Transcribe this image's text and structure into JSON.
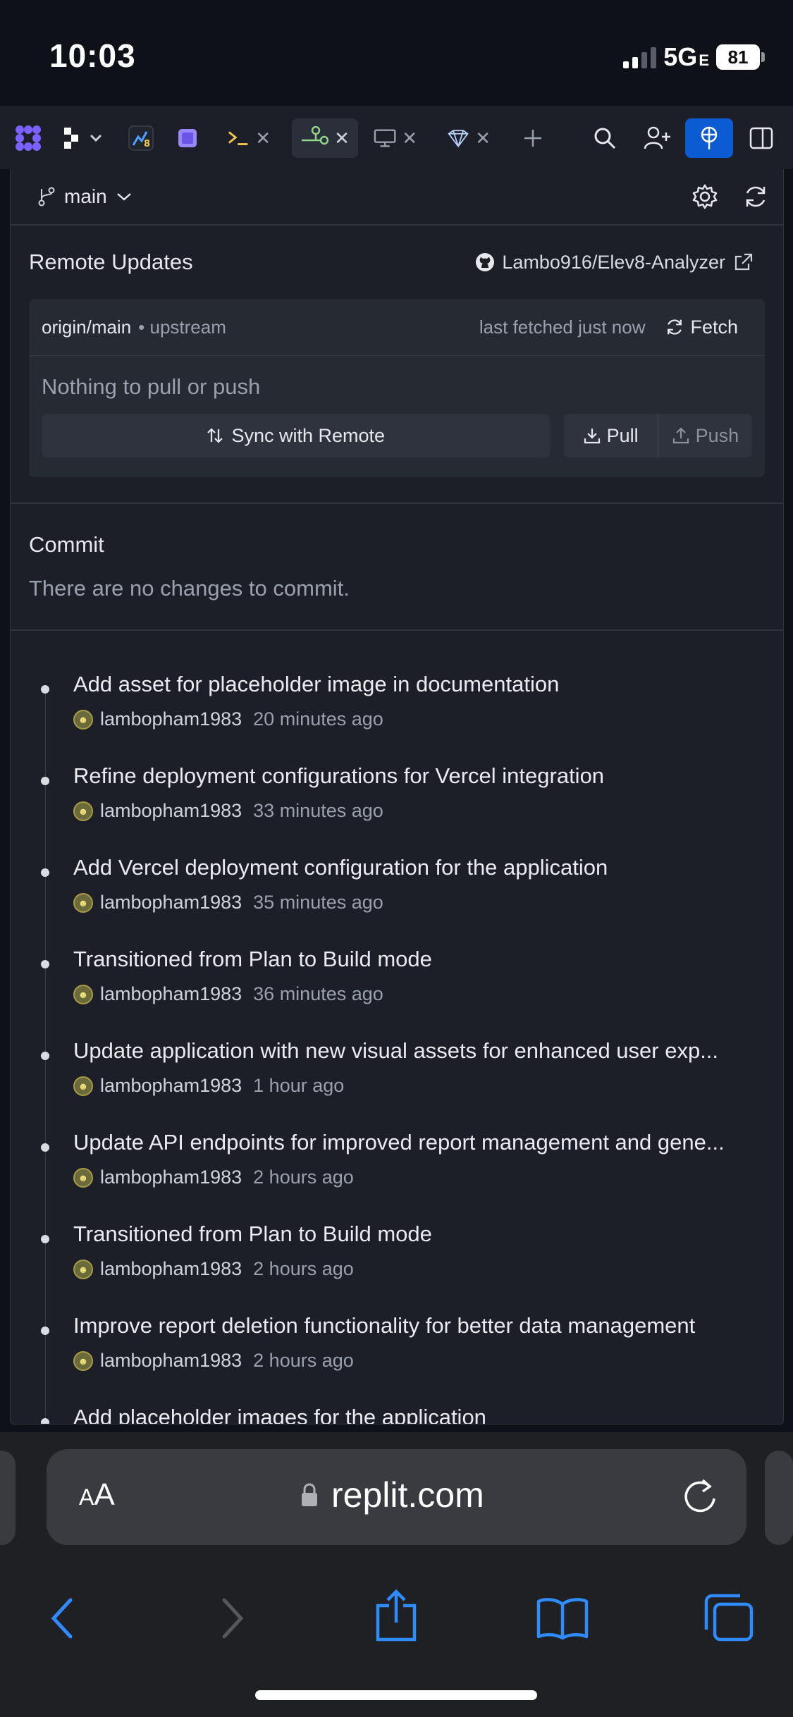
{
  "status_bar": {
    "time": "10:03",
    "network": "5G",
    "network_suffix": "E",
    "battery": "81"
  },
  "toolbar": {
    "items": [
      {
        "name": "apps-icon"
      },
      {
        "name": "workspace-switcher-icon"
      },
      {
        "name": "repl-avatar-icon"
      },
      {
        "name": "preview-square-icon"
      },
      {
        "name": "shell-tab"
      },
      {
        "name": "git-tab"
      },
      {
        "name": "webview-tab"
      },
      {
        "name": "agent-tab"
      },
      {
        "name": "new-tab"
      },
      {
        "name": "search-icon"
      },
      {
        "name": "invite-icon"
      },
      {
        "name": "deploy-icon"
      },
      {
        "name": "sidebar-toggle-icon"
      }
    ],
    "colors": {
      "accent_blue": "#0b5bd3",
      "git_green": "#8fd48a",
      "shell_yellow": "#f2c94c",
      "purple": "#7b61ff"
    }
  },
  "branch": {
    "name": "main"
  },
  "remote": {
    "title": "Remote Updates",
    "repo": "Lambo916/Elev8-Analyzer",
    "origin": "origin/main",
    "upstream": "• upstream",
    "fetched": "last fetched just now",
    "fetch_label": "Fetch",
    "status": "Nothing to pull or push",
    "sync_label": "Sync with Remote",
    "pull_label": "Pull",
    "push_label": "Push"
  },
  "commit": {
    "title": "Commit",
    "empty_message": "There are no changes to commit."
  },
  "history": [
    {
      "message": "Add asset for placeholder image in documentation",
      "author": "lambopham1983",
      "time": "20 minutes ago"
    },
    {
      "message": "Refine deployment configurations for Vercel integration",
      "author": "lambopham1983",
      "time": "33 minutes ago"
    },
    {
      "message": "Add Vercel deployment configuration for the application",
      "author": "lambopham1983",
      "time": "35 minutes ago"
    },
    {
      "message": "Transitioned from Plan to Build mode",
      "author": "lambopham1983",
      "time": "36 minutes ago"
    },
    {
      "message": "Update application with new visual assets for enhanced user exp...",
      "author": "lambopham1983",
      "time": "1 hour ago"
    },
    {
      "message": "Update API endpoints for improved report management and gene...",
      "author": "lambopham1983",
      "time": "2 hours ago"
    },
    {
      "message": "Transitioned from Plan to Build mode",
      "author": "lambopham1983",
      "time": "2 hours ago"
    },
    {
      "message": "Improve report deletion functionality for better data management",
      "author": "lambopham1983",
      "time": "2 hours ago"
    },
    {
      "message": "Add placeholder images for the application",
      "author": "",
      "time": ""
    }
  ],
  "safari": {
    "text_size_label": "AA",
    "domain": "replit.com"
  }
}
